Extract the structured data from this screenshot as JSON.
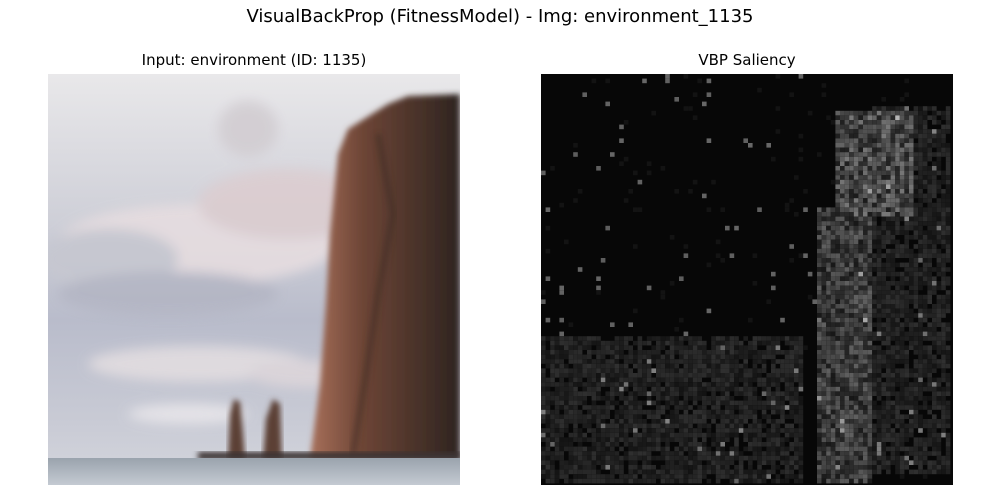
{
  "figure": {
    "title": "VisualBackProp (FitnessModel) - Img: environment_1135"
  },
  "panels": [
    {
      "title": "Input: environment (ID: 1135)",
      "content": "photo of sea stacks and a tall cliff over the sea under a cloudy sky"
    },
    {
      "title": "VBP Saliency",
      "content": "grayscale saliency map, bright speckles concentrated on the cliff region"
    }
  ],
  "colors": {
    "background": "#ffffff",
    "saliency_bg": "#070707",
    "cliff": "#5a3a2e",
    "sky": "#dcdde2"
  }
}
